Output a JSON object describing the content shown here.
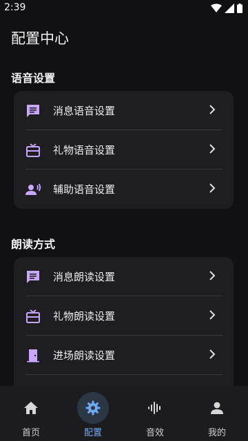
{
  "status_bar": {
    "time": "2:39"
  },
  "page": {
    "title": "配置中心"
  },
  "sections": [
    {
      "title": "语音设置",
      "items": [
        {
          "label": "消息语音设置",
          "icon": "message-icon"
        },
        {
          "label": "礼物语音设置",
          "icon": "gift-icon"
        },
        {
          "label": "辅助语音设置",
          "icon": "voice-person-icon"
        }
      ]
    },
    {
      "title": "朗读方式",
      "items": [
        {
          "label": "消息朗读设置",
          "icon": "message-icon"
        },
        {
          "label": "礼物朗读设置",
          "icon": "gift-icon"
        },
        {
          "label": "进场朗读设置",
          "icon": "door-icon"
        }
      ]
    }
  ],
  "bottom_nav": [
    {
      "label": "首页",
      "icon": "home-icon",
      "active": false
    },
    {
      "label": "配置",
      "icon": "gear-icon",
      "active": true
    },
    {
      "label": "音效",
      "icon": "waveform-icon",
      "active": false
    },
    {
      "label": "我的",
      "icon": "person-icon",
      "active": false
    }
  ],
  "colors": {
    "background": "#111013",
    "card": "#1e1d22",
    "icon_purple": "#c7a8ff",
    "active_blue": "#6fa8f5",
    "active_pill": "#2c3746"
  }
}
